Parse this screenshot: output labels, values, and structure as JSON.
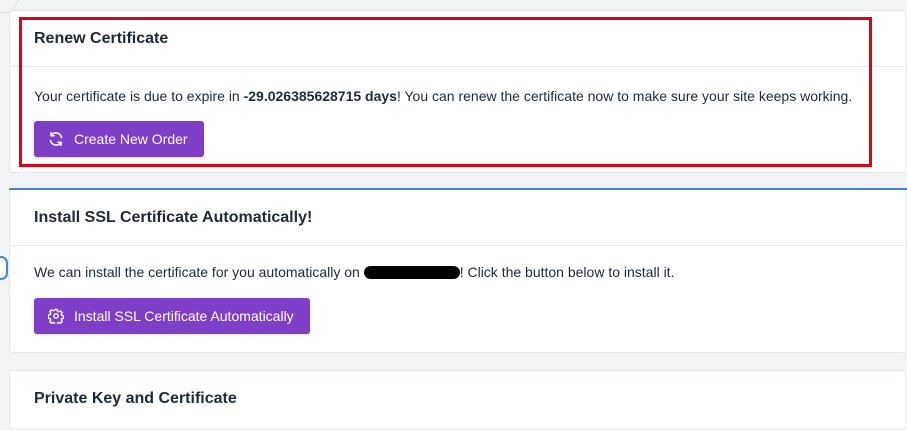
{
  "renew": {
    "title": "Renew Certificate",
    "text_before": "Your certificate is due to expire in ",
    "days_value": "-29.026385628715 days",
    "text_after": "! You can renew the certificate now to make sure your site keeps working.",
    "button_label": "Create New Order",
    "button_icon": "refresh-icon"
  },
  "install": {
    "title": "Install SSL Certificate Automatically!",
    "text_before": "We can install the certificate for you automatically on ",
    "text_after": "! Click the button below to install it.",
    "button_label": "Install SSL Certificate Automatically",
    "button_icon": "gear-icon"
  },
  "private_key": {
    "title": "Private Key and Certificate"
  },
  "colors": {
    "accent": "#7e3ec8",
    "highlight": "#e3000f",
    "blue_accent": "#3b82f6"
  }
}
